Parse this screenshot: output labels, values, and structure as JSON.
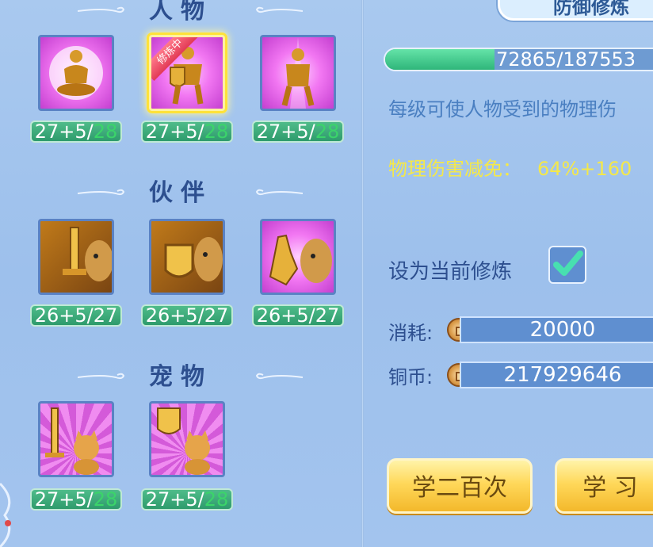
{
  "sections": {
    "character": {
      "title": "人物"
    },
    "partner": {
      "title": "伙伴"
    },
    "pet": {
      "title": "宠物"
    }
  },
  "character_items": [
    {
      "icon": "meditating-warrior-icon",
      "level": "27+5/",
      "max": "28"
    },
    {
      "icon": "shield-warrior-icon",
      "level": "27+5/",
      "max": "28",
      "selected": true,
      "tag": "修炼中"
    },
    {
      "icon": "guardian-warrior-icon",
      "level": "27+5/",
      "max": "28"
    }
  ],
  "partner_items": [
    {
      "icon": "sword-lion-icon",
      "level": "26+5/27"
    },
    {
      "icon": "shield-lion-icon",
      "level": "26+5/27"
    },
    {
      "icon": "gauntlet-lion-icon",
      "level": "26+5/27"
    }
  ],
  "pet_items": [
    {
      "icon": "sword-cat-icon",
      "level": "27+5/",
      "max": "28"
    },
    {
      "icon": "shield-cat-icon",
      "level": "27+5/",
      "max": "28"
    }
  ],
  "tab": {
    "label": "防御修炼"
  },
  "exp": {
    "text": "72865/187553",
    "current": 72865,
    "total": 187553
  },
  "description": "每级可使人物受到的物理伤",
  "stat": {
    "label": "物理伤害减免：",
    "value": "64%+160"
  },
  "set_current": {
    "label": "设为当前修炼",
    "checked": true
  },
  "cost": {
    "label": "消耗:",
    "value": "20000",
    "icon": "copper-coin-icon"
  },
  "copper": {
    "label": "铜币:",
    "value": "217929646",
    "icon": "copper-coin-icon"
  },
  "buttons": {
    "learn_200": "学二百次",
    "learn": "学 习"
  },
  "colors": {
    "level_bar": "#2e9b6c",
    "max_level": "#3bd46a",
    "stat_text": "#f4e84a",
    "button": "#ffd85a"
  }
}
